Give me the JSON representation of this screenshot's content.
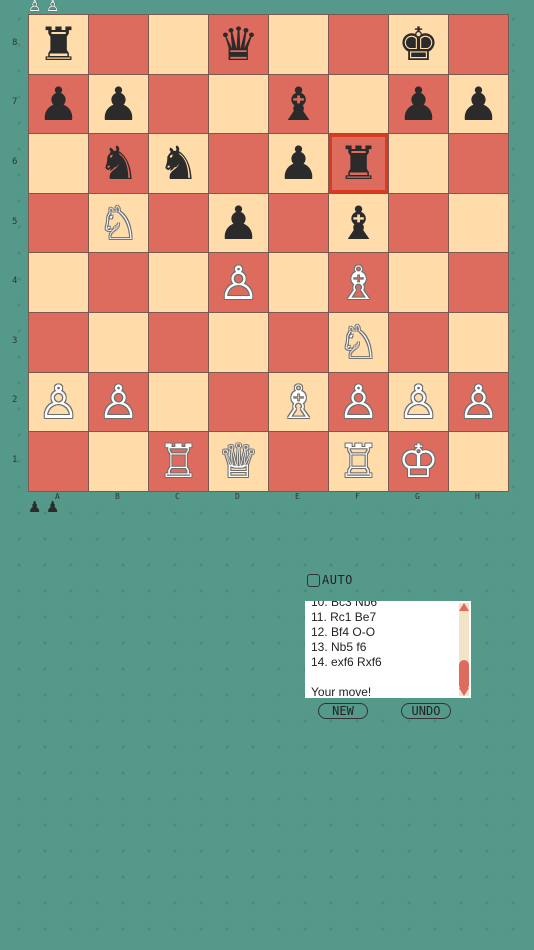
{
  "board": {
    "files": [
      "a",
      "b",
      "c",
      "d",
      "e",
      "f",
      "g",
      "h"
    ],
    "ranks": [
      "8",
      "7",
      "6",
      "5",
      "4",
      "3",
      "2",
      "1"
    ],
    "selected_square": "f6",
    "pieces": [
      {
        "square": "a8",
        "color": "b",
        "type": "rook"
      },
      {
        "square": "d8",
        "color": "b",
        "type": "queen"
      },
      {
        "square": "g8",
        "color": "b",
        "type": "king"
      },
      {
        "square": "a7",
        "color": "b",
        "type": "pawn"
      },
      {
        "square": "b7",
        "color": "b",
        "type": "pawn"
      },
      {
        "square": "e7",
        "color": "b",
        "type": "bishop"
      },
      {
        "square": "g7",
        "color": "b",
        "type": "pawn"
      },
      {
        "square": "h7",
        "color": "b",
        "type": "pawn"
      },
      {
        "square": "b6",
        "color": "b",
        "type": "knight"
      },
      {
        "square": "c6",
        "color": "b",
        "type": "knight"
      },
      {
        "square": "e6",
        "color": "b",
        "type": "pawn"
      },
      {
        "square": "f6",
        "color": "b",
        "type": "rook"
      },
      {
        "square": "b5",
        "color": "w",
        "type": "knight"
      },
      {
        "square": "d5",
        "color": "b",
        "type": "pawn"
      },
      {
        "square": "f5",
        "color": "b",
        "type": "bishop"
      },
      {
        "square": "d4",
        "color": "w",
        "type": "pawn"
      },
      {
        "square": "f4",
        "color": "w",
        "type": "bishop"
      },
      {
        "square": "f3",
        "color": "w",
        "type": "knight"
      },
      {
        "square": "a2",
        "color": "w",
        "type": "pawn"
      },
      {
        "square": "b2",
        "color": "w",
        "type": "pawn"
      },
      {
        "square": "e2",
        "color": "w",
        "type": "bishop"
      },
      {
        "square": "f2",
        "color": "w",
        "type": "pawn"
      },
      {
        "square": "g2",
        "color": "w",
        "type": "pawn"
      },
      {
        "square": "h2",
        "color": "w",
        "type": "pawn"
      },
      {
        "square": "c1",
        "color": "w",
        "type": "rook"
      },
      {
        "square": "d1",
        "color": "w",
        "type": "queen"
      },
      {
        "square": "f1",
        "color": "w",
        "type": "rook"
      },
      {
        "square": "g1",
        "color": "w",
        "type": "king"
      }
    ]
  },
  "captured": {
    "top": [
      {
        "color": "w",
        "type": "pawn"
      },
      {
        "color": "w",
        "type": "pawn"
      }
    ],
    "bottom": [
      {
        "color": "b",
        "type": "pawn"
      },
      {
        "color": "b",
        "type": "pawn"
      }
    ]
  },
  "auto": {
    "label": "AUTO",
    "checked": false
  },
  "move_log": {
    "lines": [
      "10. Bc3 Nb6",
      "11. Rc1 Be7",
      "12. Bf4 O-O",
      "13. Nb5 f6",
      "14. exf6 Rxf6"
    ],
    "status": "Your move!"
  },
  "buttons": {
    "new": "NEW",
    "undo": "UNDO"
  },
  "colors": {
    "background": "#55998a",
    "light_square": "#ffdcaa",
    "dark_square": "#de6c5e",
    "highlight": "#d93a22"
  }
}
